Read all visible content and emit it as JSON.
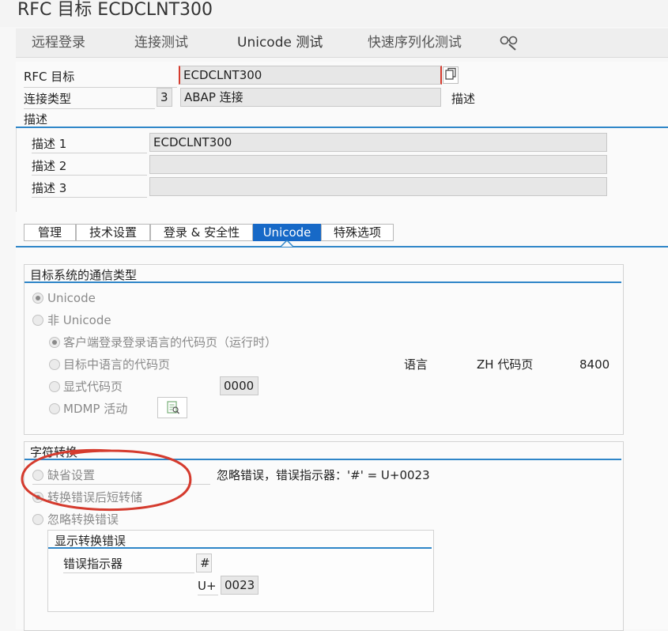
{
  "window": {
    "title": "RFC 目标 ECDCLNT300"
  },
  "toolbar": {
    "remote_login": "远程登录",
    "connection_test": "连接测试",
    "unicode_test": "Unicode 测试",
    "fast_serialization_test": "快速序列化测试"
  },
  "header": {
    "rfc_dest_label": "RFC 目标",
    "rfc_dest_value": "ECDCLNT300",
    "conn_type_label": "连接类型",
    "conn_type_code": "3",
    "conn_type_value": "ABAP 连接",
    "desc_label": "描述"
  },
  "description": {
    "title": "描述",
    "rows": [
      {
        "label": "描述 1",
        "value": "ECDCLNT300"
      },
      {
        "label": "描述 2",
        "value": ""
      },
      {
        "label": "描述 3",
        "value": ""
      }
    ]
  },
  "tabs": [
    "管理",
    "技术设置",
    "登录 & 安全性",
    "Unicode",
    "特殊选项"
  ],
  "comm_type": {
    "title": "目标系统的通信类型",
    "unicode": "Unicode",
    "non_unicode": "非 Unicode",
    "client_codepage": "客户端登录登录语言的代码页（运行时）",
    "target_lang_codepage": "目标中语言的代码页",
    "explicit_codepage": "显式代码页",
    "explicit_codepage_value": "0000",
    "mdmp": "MDMP 活动",
    "language_label": "语言",
    "lang_codepage": "ZH 代码页",
    "codepage_number": "8400"
  },
  "char_conv": {
    "title": "字符转换",
    "default_setting": "缺省设置",
    "ignore_note": "忽略错误，错误指示器：'#' = U+0023",
    "short_dump": "转换错误后短转储",
    "ignore_errors": "忽略转换错误",
    "display_errors_title": "显示转换错误",
    "error_indicator_label": "错误指示器",
    "error_indicator_value": "#",
    "u_plus_label": "U+",
    "u_plus_value": "0023"
  },
  "colors": {
    "accent_blue": "#1769c7",
    "line_blue": "#2f86c8",
    "annotation_red": "#d53b2e"
  }
}
